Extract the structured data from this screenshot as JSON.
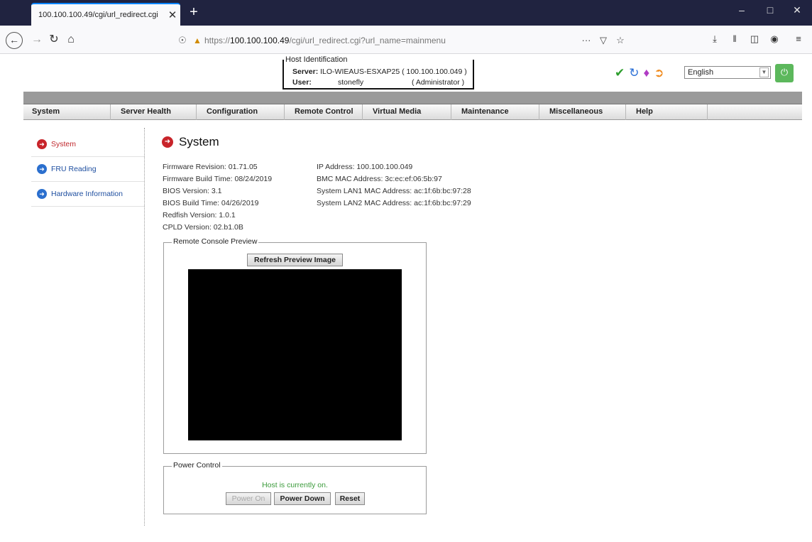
{
  "browser": {
    "tab_title": "100.100.100.49/cgi/url_redirect.cgi",
    "url_prefix": "https://",
    "url_host": "100.100.100.49",
    "url_path": "/cgi/url_redirect.cgi?url_name=mainmenu",
    "more_label": "···"
  },
  "header": {
    "host_legend": "Host Identification",
    "server_label": "Server:",
    "server_value": "ILO-WIEAUS-ESXAP25",
    "server_ip": "( 100.100.100.049 )",
    "user_label": "User:",
    "user_value": "stonefly",
    "user_role": "( Administrator )",
    "language": "English"
  },
  "menu": [
    {
      "label": "System"
    },
    {
      "label": "Server Health"
    },
    {
      "label": "Configuration"
    },
    {
      "label": "Remote Control"
    },
    {
      "label": "Virtual Media"
    },
    {
      "label": "Maintenance"
    },
    {
      "label": "Miscellaneous"
    },
    {
      "label": "Help"
    },
    {
      "label": ""
    }
  ],
  "sidebar": {
    "items": [
      {
        "label": "System"
      },
      {
        "label": "FRU Reading"
      },
      {
        "label": "Hardware Information"
      }
    ]
  },
  "main": {
    "title": "System",
    "left_info": [
      "Firmware Revision: 01.71.05",
      "Firmware Build Time: 08/24/2019",
      "BIOS Version: 3.1",
      "BIOS Build Time: 04/26/2019",
      "Redfish Version: 1.0.1",
      "CPLD Version: 02.b1.0B"
    ],
    "right_info": [
      "IP Address: 100.100.100.049",
      "BMC MAC Address: 3c:ec:ef:06:5b:97",
      "System LAN1 MAC Address: ac:1f:6b:bc:97:28",
      "System LAN2 MAC Address: ac:1f:6b:bc:97:29"
    ],
    "console_legend": "Remote Console Preview",
    "refresh_label": "Refresh Preview Image",
    "power_legend": "Power Control",
    "power_status": "Host is currently on.",
    "power_on_label": "Power On",
    "power_down_label": "Power Down",
    "reset_label": "Reset"
  },
  "colors": {
    "status_green": "#3a9a3a",
    "active_red": "#c8242a",
    "link_blue": "#1f4fa0"
  }
}
